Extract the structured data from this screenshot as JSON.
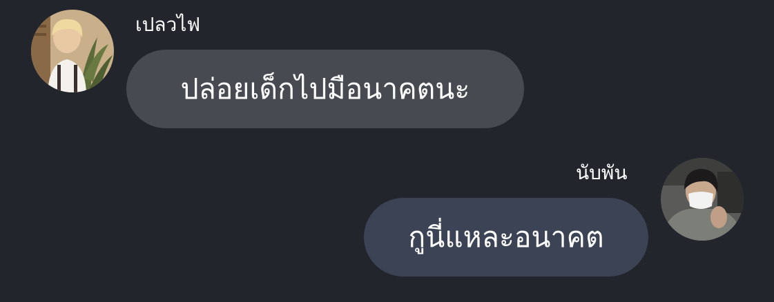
{
  "messages": [
    {
      "sender": "เปลวไฟ",
      "text": "ปล่อยเด็กไปมือนาคตนะ",
      "avatar": "profile-photo",
      "bubble_color": "#474a51"
    },
    {
      "sender": "นับพัน",
      "text": "กูนี่แหละอนาคต",
      "avatar": "profile-photo",
      "bubble_color": "#3c4354"
    }
  ],
  "colors": {
    "background": "#22252c",
    "text": "#ffffff"
  }
}
